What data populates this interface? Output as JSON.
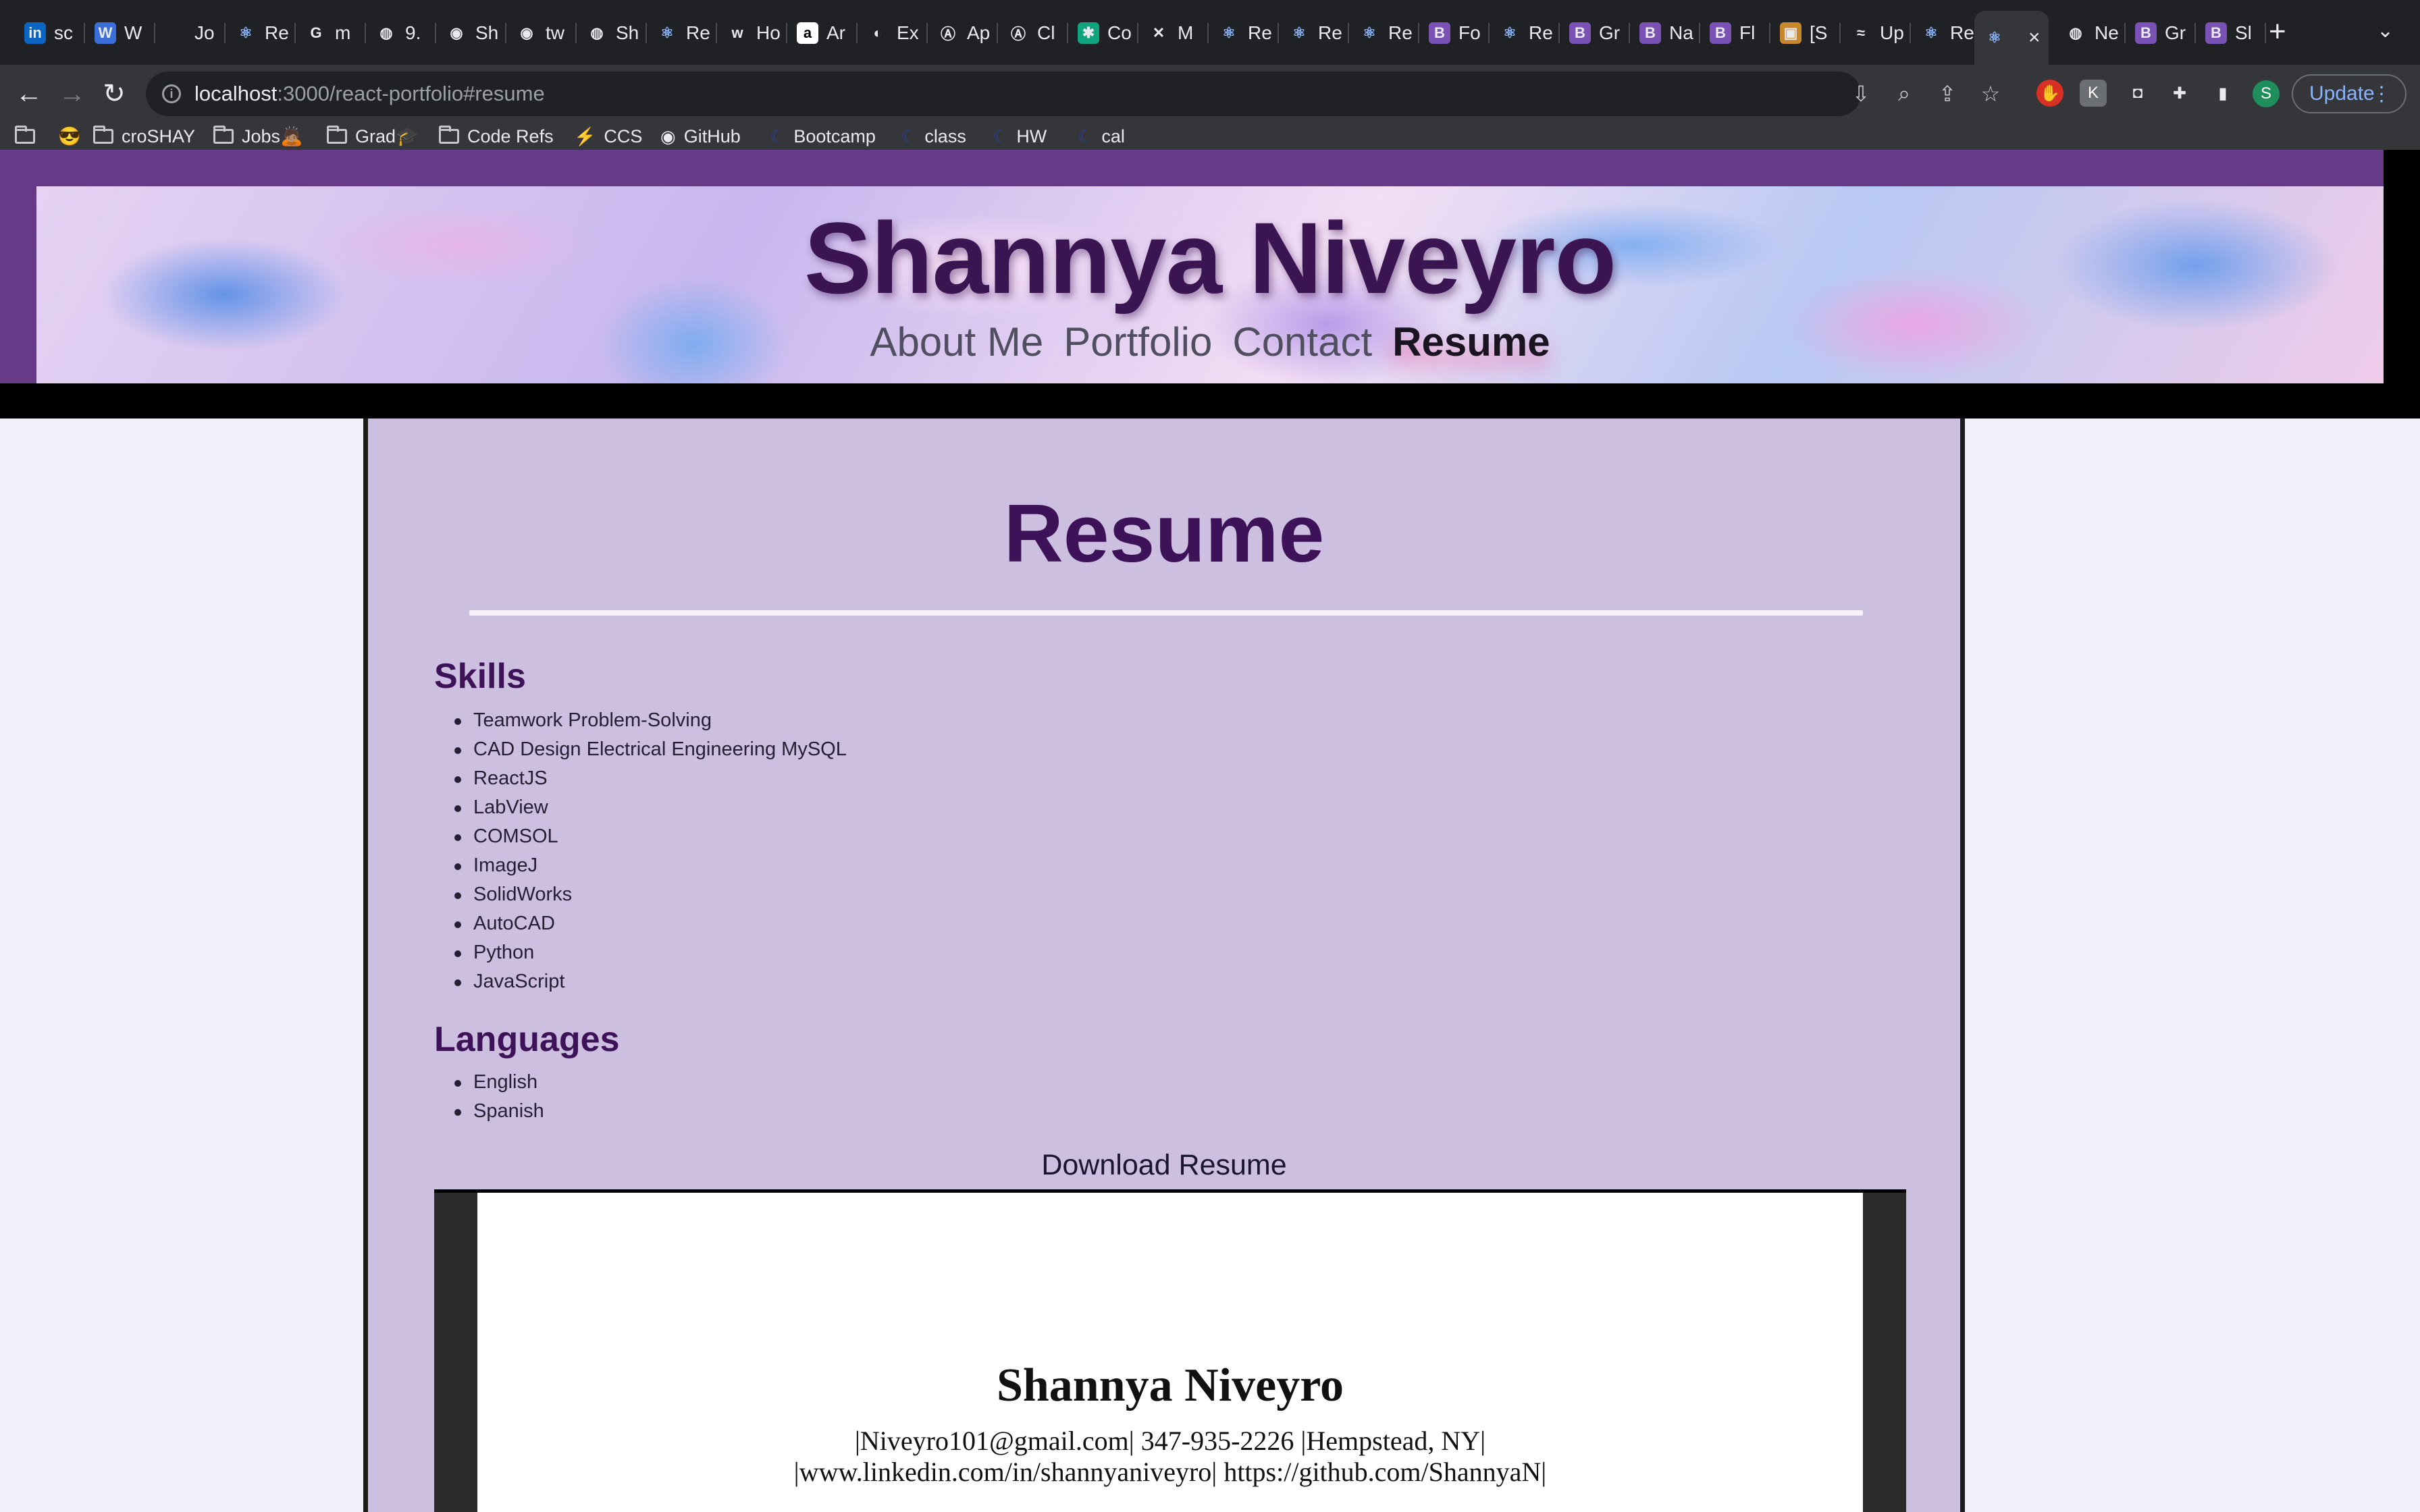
{
  "browser": {
    "tabs": [
      {
        "label": "sc",
        "icon": "linkedin-icon",
        "color": "#0a66c2",
        "glyph": "in"
      },
      {
        "label": "W",
        "icon": "wix-icon",
        "color": "#3b6ed8",
        "glyph": "W"
      },
      {
        "label": "Jo",
        "icon": "apple-icon",
        "color": "#202124",
        "glyph": ""
      },
      {
        "label": "Re",
        "icon": "react-icon",
        "color": "#202124",
        "glyph": "⚛"
      },
      {
        "label": "m",
        "icon": "google-icon",
        "color": "#202124",
        "glyph": "G"
      },
      {
        "label": "9.",
        "icon": "globe-icon",
        "color": "#202124",
        "glyph": "◍"
      },
      {
        "label": "Sh",
        "icon": "github-icon",
        "color": "#202124",
        "glyph": "◉"
      },
      {
        "label": "tw",
        "icon": "github-icon",
        "color": "#202124",
        "glyph": "◉"
      },
      {
        "label": "Sh",
        "icon": "globe-icon",
        "color": "#202124",
        "glyph": "◍"
      },
      {
        "label": "Re",
        "icon": "react-icon",
        "color": "#202124",
        "glyph": "⚛"
      },
      {
        "label": "Ho",
        "icon": "w-icon",
        "color": "#202124",
        "glyph": "w"
      },
      {
        "label": "Ar",
        "icon": "amazon-icon",
        "color": "#ffffff",
        "glyph": "a"
      },
      {
        "label": "Ex",
        "icon": "circle-icon",
        "color": "#202124",
        "glyph": "◐"
      },
      {
        "label": "Ap",
        "icon": "a-circle-icon",
        "color": "#202124",
        "glyph": "Ⓐ"
      },
      {
        "label": "Cl",
        "icon": "a-circle-icon",
        "color": "#202124",
        "glyph": "Ⓐ"
      },
      {
        "label": "Co",
        "icon": "openai-icon",
        "color": "#10a37f",
        "glyph": "✱"
      },
      {
        "label": "M",
        "icon": "sword-icon",
        "color": "#202124",
        "glyph": "✕"
      },
      {
        "label": "Re",
        "icon": "react-icon",
        "color": "#202124",
        "glyph": "⚛"
      },
      {
        "label": "Re",
        "icon": "react-icon",
        "color": "#202124",
        "glyph": "⚛"
      },
      {
        "label": "Re",
        "icon": "react-icon",
        "color": "#202124",
        "glyph": "⚛"
      },
      {
        "label": "Fo",
        "icon": "bootstrap-icon",
        "color": "#7952b3",
        "glyph": "B"
      },
      {
        "label": "Re",
        "icon": "react-icon",
        "color": "#202124",
        "glyph": "⚛"
      },
      {
        "label": "Gr",
        "icon": "bootstrap-icon",
        "color": "#7952b3",
        "glyph": "B"
      },
      {
        "label": "Na",
        "icon": "bootstrap-icon",
        "color": "#7952b3",
        "glyph": "B"
      },
      {
        "label": "Fl",
        "icon": "bootstrap-icon",
        "color": "#7952b3",
        "glyph": "B"
      },
      {
        "label": "[S",
        "icon": "image-icon",
        "color": "#c7882b",
        "glyph": "▣"
      },
      {
        "label": "Up",
        "icon": "bolt-icon",
        "color": "#202124",
        "glyph": "≈"
      },
      {
        "label": "Re",
        "icon": "react-icon",
        "color": "#202124",
        "glyph": "⚛"
      },
      {
        "label": "",
        "icon": "react-icon",
        "color": "#202124",
        "glyph": "⚛",
        "active": true
      },
      {
        "label": "Ne",
        "icon": "chrome-icon",
        "color": "#202124",
        "glyph": "◍"
      },
      {
        "label": "Gr",
        "icon": "bootstrap-icon",
        "color": "#7952b3",
        "glyph": "B"
      },
      {
        "label": "Sl",
        "icon": "bootstrap-icon",
        "color": "#7952b3",
        "glyph": "B"
      }
    ],
    "address": {
      "host": "localhost",
      "path": ":3000/react-portfolio#resume"
    },
    "update_label": "Update",
    "profile_initial": "S",
    "bookmarks": [
      {
        "label": "",
        "icon": "folder-icon"
      },
      {
        "label": "😎",
        "icon": "emoji-icon"
      },
      {
        "label": "croSHAY",
        "icon": "folder-icon"
      },
      {
        "label": "Jobs🙇🏽",
        "icon": "folder-icon"
      },
      {
        "label": "Grad🎓",
        "icon": "folder-icon"
      },
      {
        "label": "Code Refs",
        "icon": "folder-icon"
      },
      {
        "label": "CCS",
        "icon": "ccs-icon"
      },
      {
        "label": "GitHub",
        "icon": "github-icon"
      },
      {
        "label": "Bootcamp",
        "icon": "bootcamp-icon"
      },
      {
        "label": "class",
        "icon": "bootcamp-icon"
      },
      {
        "label": "HW",
        "icon": "bootcamp-icon"
      },
      {
        "label": "cal",
        "icon": "bootcamp-icon"
      }
    ]
  },
  "site": {
    "title": "Shannya Niveyro",
    "nav": [
      {
        "label": "About Me",
        "active": false
      },
      {
        "label": "Portfolio",
        "active": false
      },
      {
        "label": "Contact",
        "active": false
      },
      {
        "label": "Resume",
        "active": true
      }
    ]
  },
  "resume": {
    "heading": "Resume",
    "skills_title": "Skills",
    "skills": [
      "Teamwork Problem-Solving",
      "CAD Design Electrical Engineering MySQL",
      "ReactJS",
      "LabView",
      "COMSOL",
      "ImageJ",
      "SolidWorks",
      "AutoCAD",
      "Python",
      "JavaScript"
    ],
    "languages_title": "Languages",
    "languages": [
      "English",
      "Spanish"
    ],
    "download_label": "Download Resume",
    "pdf": {
      "name": "Shannya Niveyro",
      "contact_line": "|Niveyro101@gmail.com| 347-935-2226 |Hempstead, NY|",
      "links_line": "|www.linkedin.com/in/shannyaniveyro| https://github.com/ShannyaN|"
    }
  },
  "colors": {
    "accent": "#3e1258",
    "header": "#663a86",
    "panel": "#cdbfe0"
  }
}
